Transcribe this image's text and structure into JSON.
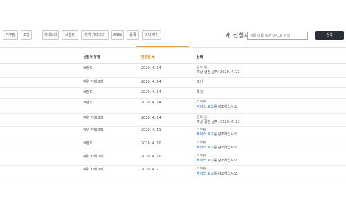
{
  "toolbar": {
    "filters": [
      "거부됨",
      "조건",
      "카테고리",
      "브랜드",
      "하위 카테고리",
      "ASIN",
      "등록",
      "미처 제기"
    ],
    "new_request_title": "새 신청서",
    "search_placeholder": "상품 이름 또는 UPC로 검색",
    "search_button": "검색"
  },
  "table": {
    "headers": {
      "type": "신청서 유형",
      "date": "변경일 ▼",
      "status": "상태"
    },
    "rows": [
      {
        "type": "브랜드",
        "date": "2020. 4. 14",
        "status_line1": "검토 중",
        "status_line2": "예상 결정 날짜: 2020. 4. 21",
        "link": "",
        "status_suffix": ""
      },
      {
        "type": "하위 카테고리",
        "date": "2020. 4. 14",
        "status_line1": "조건",
        "status_line2": "",
        "link": "",
        "status_suffix": ""
      },
      {
        "type": "브랜드",
        "date": "2020. 4. 14",
        "status_line1": "조건",
        "status_line2": "",
        "link": "",
        "status_suffix": ""
      },
      {
        "type": "브랜드",
        "date": "2020. 4. 14",
        "status_line1": "거부됨",
        "status_line2": "",
        "link": "케이스 로그",
        "status_suffix": "를 참조하십시오."
      },
      {
        "type": "하위 카테고리",
        "date": "2020. 4. 14",
        "status_line1": "검토 중",
        "status_line2": "예상 결정 날짜: 2020. 4. 21",
        "link": "",
        "status_suffix": ""
      },
      {
        "type": "하위 카테고리",
        "date": "2020. 4. 11",
        "status_line1": "거부됨",
        "status_line2": "",
        "link": "케이스 로그",
        "status_suffix": "를 참조하십시오."
      },
      {
        "type": "브랜드",
        "date": "2020. 4. 10",
        "status_line1": "거부됨",
        "status_line2": "",
        "link": "케이스 로그",
        "status_suffix": "를 참조하십시오."
      },
      {
        "type": "하위 카테고리",
        "date": "2020. 4. 10",
        "status_line1": "거부됨",
        "status_line2": "",
        "link": "케이스 로그",
        "status_suffix": "를 참조하십시오."
      },
      {
        "type": "하위 카테고리",
        "date": "2020. 4. 2",
        "status_line1": "거부됨",
        "status_line2": "",
        "link": "케이스 로그",
        "status_suffix": "를 참조하십시오."
      }
    ]
  }
}
